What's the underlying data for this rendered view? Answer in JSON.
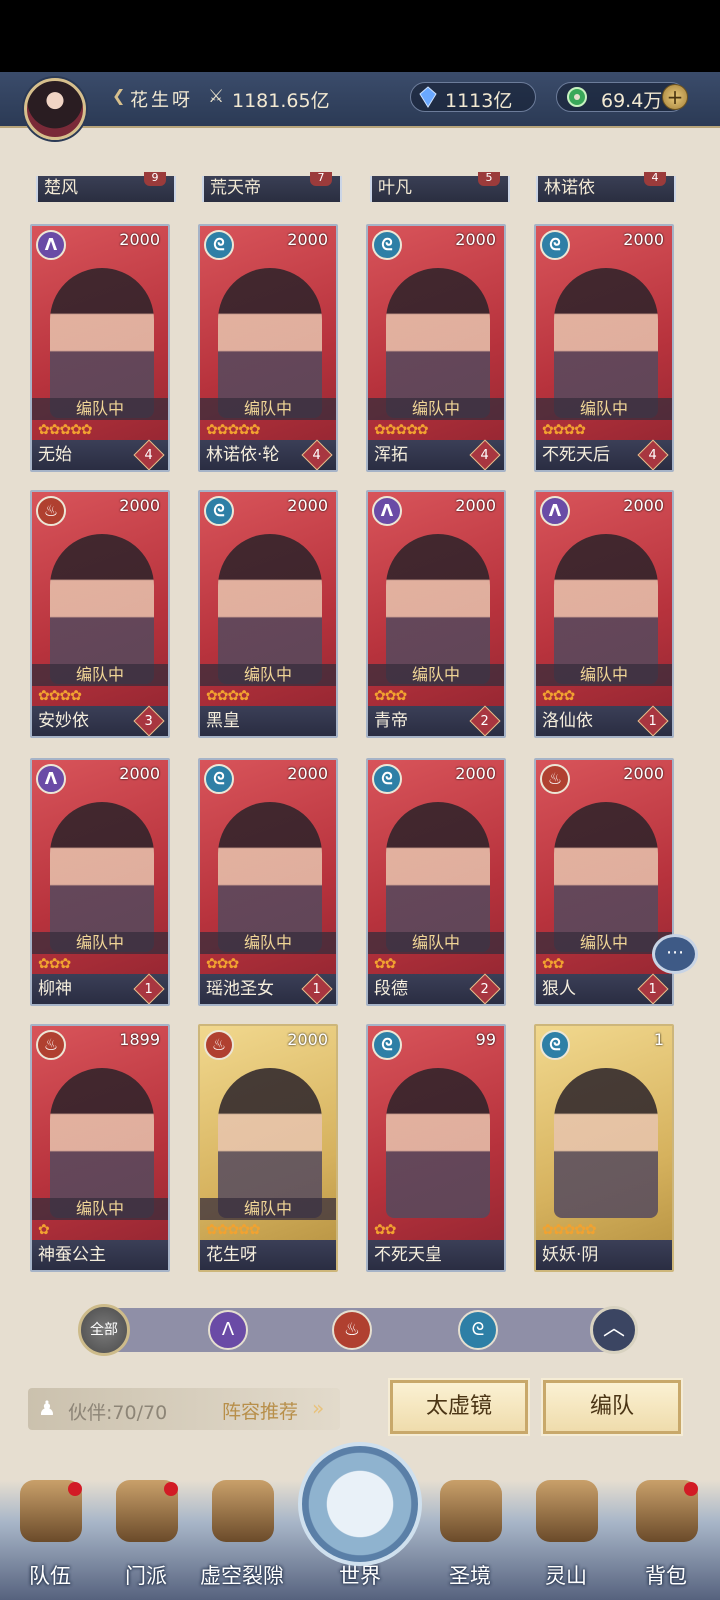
{
  "header": {
    "player_name": "花生呀",
    "power": "1181.65亿",
    "crystal": "1113亿",
    "jade": "69.4万",
    "plus_label": "+"
  },
  "prev_row": [
    {
      "name": "楚风",
      "badge": "9"
    },
    {
      "name": "荒天帝",
      "badge": "7"
    },
    {
      "name": "叶凡",
      "badge": "5"
    },
    {
      "name": "林诺依",
      "badge": "4"
    }
  ],
  "cards": [
    {
      "name": "无始",
      "level": "2000",
      "element": "wind",
      "stars": "✿✿✿✿✿",
      "num": "4",
      "team": "编队中",
      "gold": false
    },
    {
      "name": "林诺依·轮",
      "level": "2000",
      "element": "water",
      "stars": "✿✿✿✿✿",
      "num": "4",
      "team": "编队中",
      "gold": false
    },
    {
      "name": "浑拓",
      "level": "2000",
      "element": "water",
      "stars": "✿✿✿✿✿",
      "num": "4",
      "team": "编队中",
      "gold": false
    },
    {
      "name": "不死天后",
      "level": "2000",
      "element": "water",
      "stars": "✿✿✿✿",
      "num": "4",
      "team": "编队中",
      "gold": false
    },
    {
      "name": "安妙依",
      "level": "2000",
      "element": "fire",
      "stars": "✿✿✿✿",
      "num": "3",
      "team": "编队中",
      "gold": false
    },
    {
      "name": "黑皇",
      "level": "2000",
      "element": "water",
      "stars": "✿✿✿✿",
      "num": "",
      "team": "编队中",
      "gold": false
    },
    {
      "name": "青帝",
      "level": "2000",
      "element": "wind",
      "stars": "✿✿✿",
      "num": "2",
      "team": "编队中",
      "gold": false
    },
    {
      "name": "洛仙依",
      "level": "2000",
      "element": "wind",
      "stars": "✿✿✿",
      "num": "1",
      "team": "编队中",
      "gold": false
    },
    {
      "name": "柳神",
      "level": "2000",
      "element": "wind",
      "stars": "✿✿✿",
      "num": "1",
      "team": "编队中",
      "gold": false
    },
    {
      "name": "瑶池圣女",
      "level": "2000",
      "element": "water",
      "stars": "✿✿✿",
      "num": "1",
      "team": "编队中",
      "gold": false
    },
    {
      "name": "段德",
      "level": "2000",
      "element": "water",
      "stars": "✿✿",
      "num": "2",
      "team": "编队中",
      "gold": false
    },
    {
      "name": "狠人",
      "level": "2000",
      "element": "fire",
      "stars": "✿✿",
      "num": "1",
      "team": "编队中",
      "gold": false
    },
    {
      "name": "神蚕公主",
      "level": "1899",
      "element": "fire",
      "stars": "✿",
      "num": "",
      "team": "编队中",
      "gold": false
    },
    {
      "name": "花生呀",
      "level": "2000",
      "element": "fire",
      "stars": "✿✿✿✿✿",
      "num": "",
      "team": "编队中",
      "gold": true
    },
    {
      "name": "不死天皇",
      "level": "99",
      "element": "water",
      "stars": "✿✿",
      "num": "",
      "team": "",
      "gold": false
    },
    {
      "name": "妖妖·阴",
      "level": "1",
      "element": "water",
      "stars": "✿✿✿✿✿",
      "num": "",
      "team": "",
      "gold": true
    }
  ],
  "filters": {
    "all": "全部"
  },
  "partner": {
    "label": "伙伴:70/70",
    "recommend": "阵容推荐"
  },
  "buttons": {
    "mirror": "太虚镜",
    "team": "编队"
  },
  "nav": [
    {
      "label": "队伍",
      "dot": true
    },
    {
      "label": "门派",
      "dot": true
    },
    {
      "label": "虚空裂隙",
      "dot": false
    },
    {
      "label": "世界",
      "dot": false
    },
    {
      "label": "圣境",
      "dot": false
    },
    {
      "label": "灵山",
      "dot": false
    },
    {
      "label": "背包",
      "dot": true
    }
  ],
  "icons": {
    "water": "water-element-icon",
    "wind": "wind-element-icon",
    "fire": "fire-element-icon"
  }
}
